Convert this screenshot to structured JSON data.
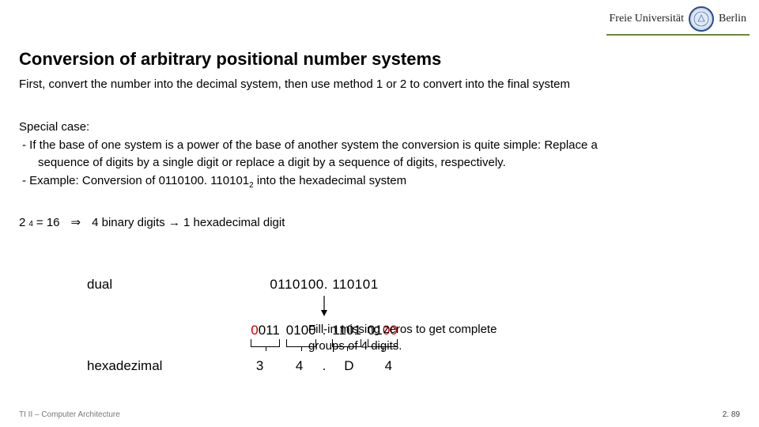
{
  "logo": {
    "left": "Freie Universität",
    "right": "Berlin"
  },
  "title": "Conversion of arbitrary positional number systems",
  "intro": "First, convert the number into the decimal system, then use method 1 or 2 to convert into the final system",
  "special": {
    "head": "Special case:",
    "bullet1a": "- If the base of one system is a power of the base of another system the conversion is quite simple: Replace a",
    "bullet1b": "sequence of digits by a single digit or replace a digit by a sequence of digits, respectively.",
    "bullet2a": "- Example: Conversion of 0110100. 110101",
    "bullet2sub": "2",
    "bullet2b": " into the hexadecimal system"
  },
  "power": {
    "base": "2",
    "exp": "4",
    "eq": " = 16",
    "implies": "⇒",
    "rest": "4 binary digits → 1 hexadecimal digit"
  },
  "diagram": {
    "dual_label": "dual",
    "dual_number": "0110100. 110101",
    "groups": {
      "g1": {
        "pad": "0",
        "rest": "011"
      },
      "g2": {
        "pad": "",
        "rest": "0100"
      },
      "dot": ".",
      "g3": {
        "pad": "",
        "rest": "1101"
      },
      "g4": {
        "rest": "01",
        "pad": "00"
      }
    },
    "hex_label": "hexadezimal",
    "hex": {
      "h1": "3",
      "h2": "4",
      "dot": ".",
      "h3": "D",
      "h4": "4"
    },
    "fillin": "Fill-in missing zeros to get complete groups of 4 digits."
  },
  "footer": {
    "left": "TI II – Computer Architecture",
    "right": "2. 89"
  }
}
